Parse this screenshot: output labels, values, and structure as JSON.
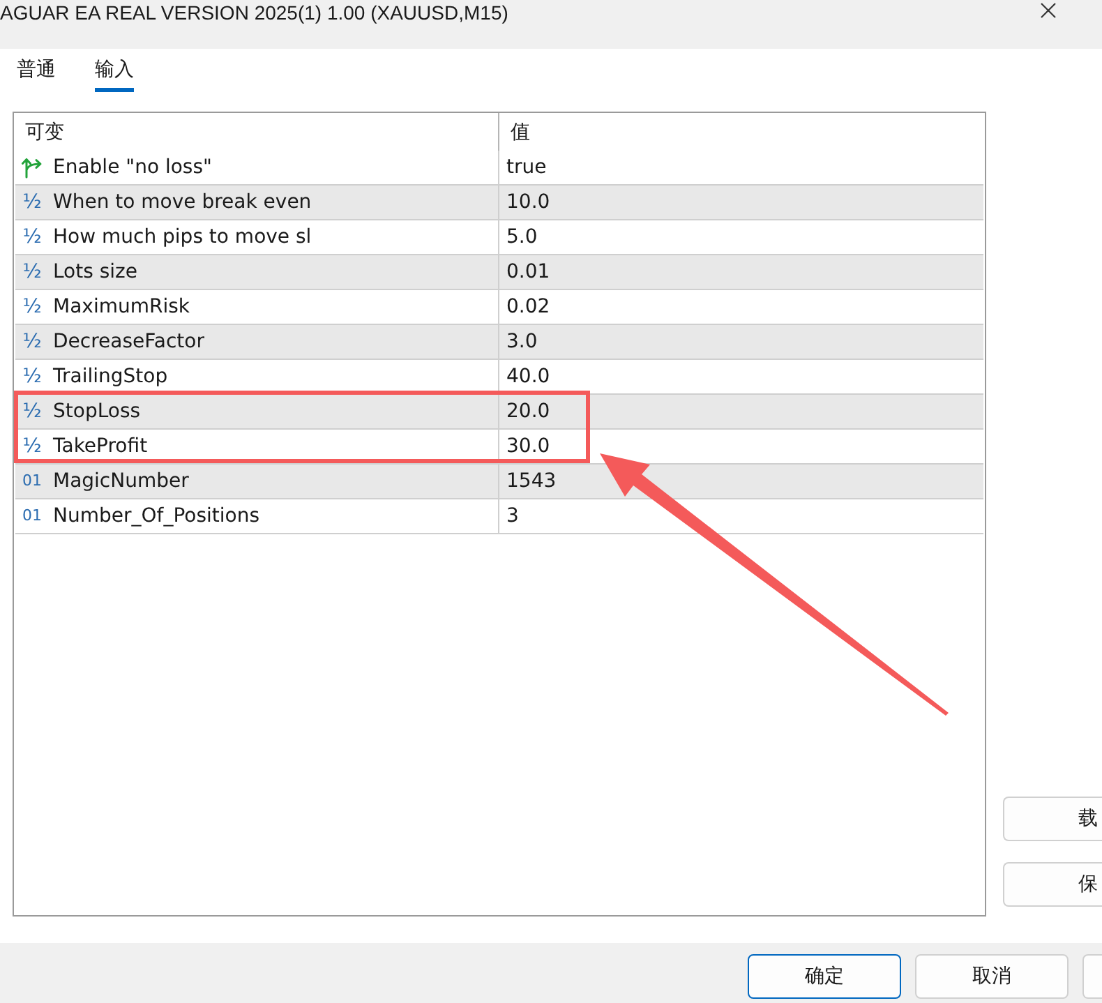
{
  "window": {
    "title": "AGUAR EA REAL VERSION 2025(1) 1.00 (XAUUSD,M15)"
  },
  "tabs": [
    {
      "label": "普通",
      "selected": false
    },
    {
      "label": "输入",
      "selected": true
    }
  ],
  "table": {
    "columns": [
      "可变",
      "值"
    ],
    "rows": [
      {
        "kind": "bool",
        "name": "Enable \"no loss\"",
        "value": "true",
        "highlighted": false
      },
      {
        "kind": "double",
        "glyph": "½",
        "name": "When to move break even",
        "value": "10.0",
        "highlighted": false
      },
      {
        "kind": "double",
        "glyph": "½",
        "name": "How much pips to move sl",
        "value": "5.0",
        "highlighted": false
      },
      {
        "kind": "double",
        "glyph": "½",
        "name": "Lots size",
        "value": "0.01",
        "highlighted": false
      },
      {
        "kind": "double",
        "glyph": "½",
        "name": "MaximumRisk",
        "value": "0.02",
        "highlighted": false
      },
      {
        "kind": "double",
        "glyph": "½",
        "name": "DecreaseFactor",
        "value": "3.0",
        "highlighted": false
      },
      {
        "kind": "double",
        "glyph": "½",
        "name": "TrailingStop",
        "value": "40.0",
        "highlighted": false
      },
      {
        "kind": "double",
        "glyph": "½",
        "name": "StopLoss",
        "value": "20.0",
        "highlighted": true
      },
      {
        "kind": "double",
        "glyph": "½",
        "name": "TakeProfit",
        "value": "30.0",
        "highlighted": true
      },
      {
        "kind": "int",
        "glyph": "01",
        "name": "MagicNumber",
        "value": "1543",
        "highlighted": false
      },
      {
        "kind": "int",
        "glyph": "01",
        "name": "Number_Of_Positions",
        "value": "3",
        "highlighted": false
      }
    ]
  },
  "side_buttons": [
    "载",
    "保"
  ],
  "buttons": [
    {
      "label": "确定",
      "default": true
    },
    {
      "label": "取消",
      "default": false
    },
    {
      "default": false
    }
  ]
}
